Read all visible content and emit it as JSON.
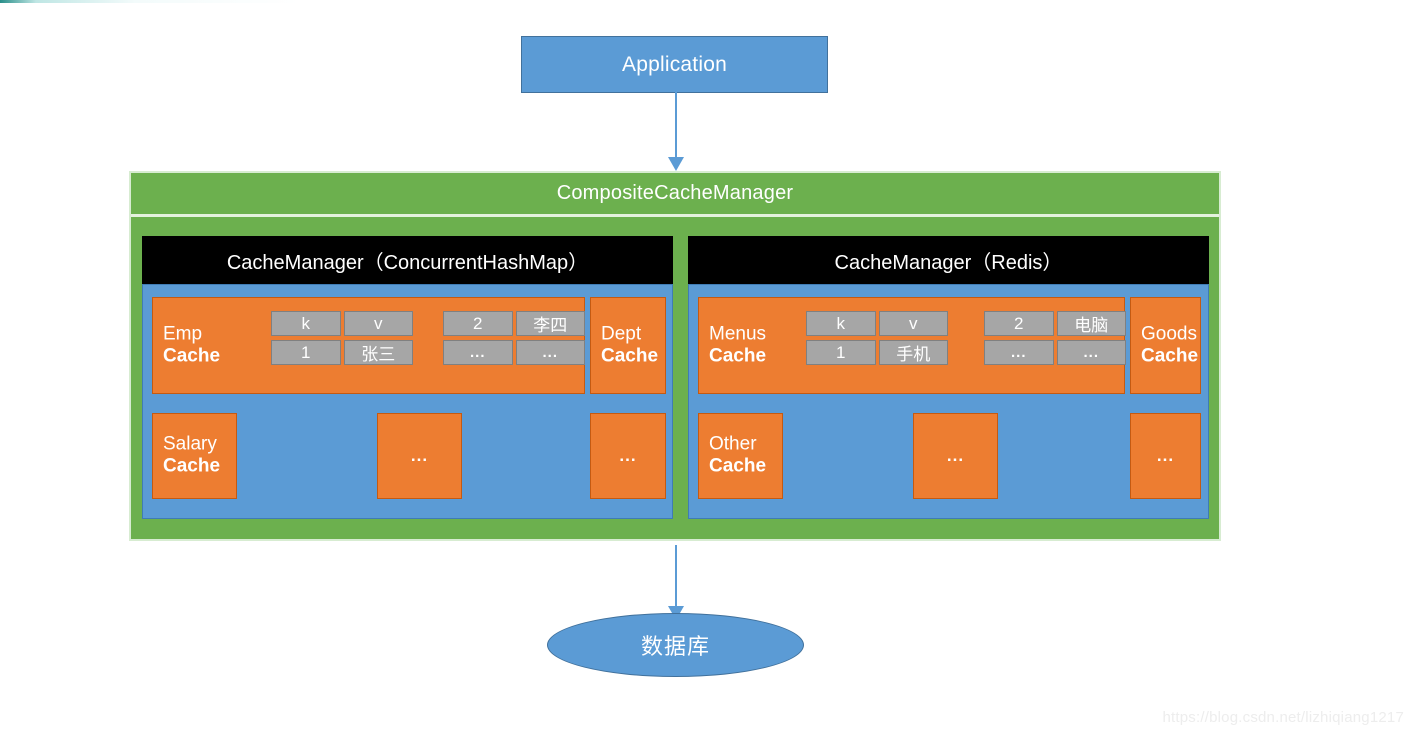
{
  "diagram": {
    "application": {
      "label": "Application"
    },
    "composite": {
      "title": "CompositeCacheManager"
    },
    "database": {
      "label": "数据库"
    },
    "watermark": "https://blog.csdn.net/lizhiqiang1217",
    "colors": {
      "green": "#6cb04e",
      "blue": "#5b9bd5",
      "orange": "#ed7d31",
      "black": "#000000",
      "gray_cell": "#a6a6a6"
    },
    "managers": [
      {
        "header": "CacheManager（ConcurrentHashMap）",
        "primary_cache": {
          "name": "Emp",
          "type": "Cache"
        },
        "kv_left": [
          [
            "k",
            "v"
          ],
          [
            "1",
            "张三"
          ]
        ],
        "kv_right": [
          [
            "2",
            "李四"
          ],
          [
            "...",
            "..."
          ]
        ],
        "side_cache": {
          "name": "Dept",
          "type": "Cache"
        },
        "second_cache": {
          "name": "Salary",
          "type": "Cache"
        },
        "placeholder_mid": "...",
        "placeholder_end": "..."
      },
      {
        "header": "CacheManager（Redis）",
        "primary_cache": {
          "name": "Menus",
          "type": "Cache"
        },
        "kv_left": [
          [
            "k",
            "v"
          ],
          [
            "1",
            "手机"
          ]
        ],
        "kv_right": [
          [
            "2",
            "电脑"
          ],
          [
            "...",
            "..."
          ]
        ],
        "side_cache": {
          "name": "Goods",
          "type": "Cache"
        },
        "second_cache": {
          "name": "Other",
          "type": "Cache"
        },
        "placeholder_mid": "...",
        "placeholder_end": "..."
      }
    ]
  }
}
